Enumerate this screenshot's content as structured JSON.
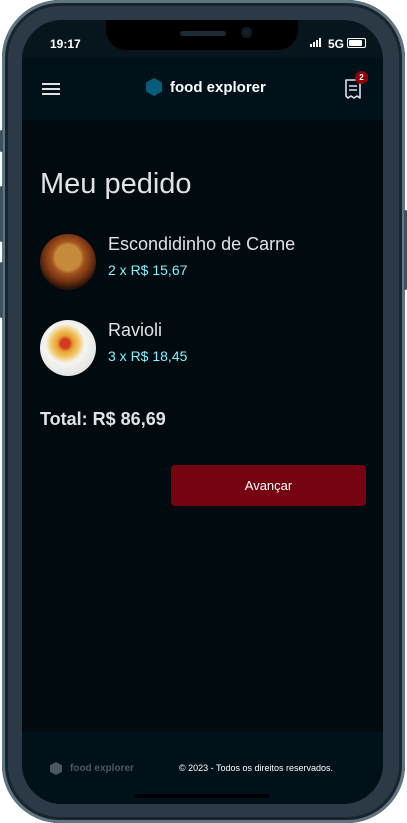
{
  "status_bar": {
    "time": "19:17",
    "network": "5G"
  },
  "header": {
    "brand": "food explorer",
    "orders_count": "2"
  },
  "main": {
    "title": "Meu pedido",
    "items": [
      {
        "name": "Escondidinho de Carne",
        "price": "2 x R$ 15,67",
        "image": "escondidinho-dish"
      },
      {
        "name": "Ravioli",
        "price": "3 x R$ 18,45",
        "image": "ravioli-dish"
      }
    ],
    "total": "Total: R$ 86,69",
    "advance_label": "Avançar"
  },
  "footer": {
    "brand": "food explorer",
    "copyright": "© 2023 - Todos os direitos reservados."
  },
  "colors": {
    "background": "#000a0f",
    "header": "#00111a",
    "accent_button": "#750310",
    "price_text": "#82f3ff",
    "brand_hex": "#065e7c",
    "badge": "#92000e"
  }
}
